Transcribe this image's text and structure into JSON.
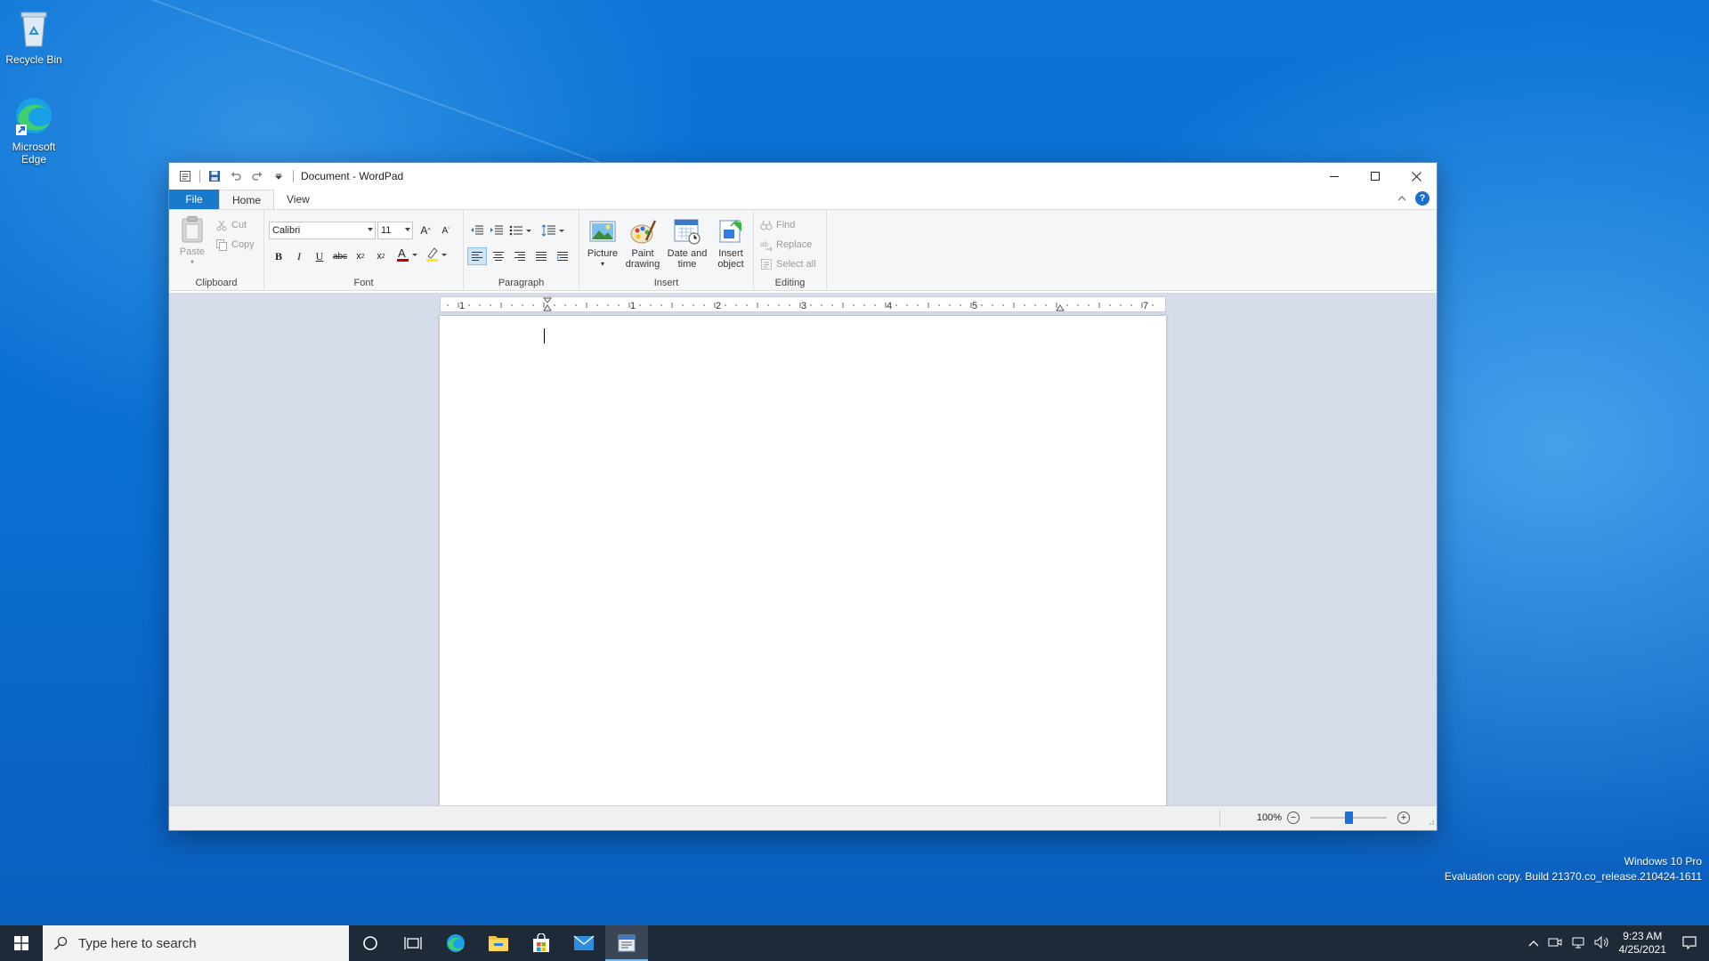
{
  "desktop": {
    "icons": [
      {
        "label": "Recycle Bin",
        "icon": "recycle-bin-icon"
      },
      {
        "label": "Microsoft Edge",
        "icon": "edge-icon"
      }
    ],
    "watermark": {
      "line1": "Windows 10 Pro",
      "line2": "Evaluation copy. Build 21370.co_release.210424-1611"
    }
  },
  "window": {
    "title": "Document - WordPad",
    "tabs": [
      {
        "label": "File"
      },
      {
        "label": "Home"
      },
      {
        "label": "View"
      }
    ],
    "ribbon": {
      "clipboard": {
        "group": "Clipboard",
        "paste": "Paste",
        "cut": "Cut",
        "copy": "Copy"
      },
      "font": {
        "group": "Font",
        "family": "Calibri",
        "size": "11"
      },
      "paragraph": {
        "group": "Paragraph"
      },
      "insert": {
        "group": "Insert",
        "picture": "Picture",
        "paint_line1": "Paint",
        "paint_line2": "drawing",
        "datetime_line1": "Date and",
        "datetime_line2": "time",
        "object_line1": "Insert",
        "object_line2": "object"
      },
      "editing": {
        "group": "Editing",
        "find": "Find",
        "replace": "Replace",
        "select_all": "Select all"
      }
    },
    "ruler_numbers": [
      "1",
      "1",
      "2",
      "3",
      "4",
      "5",
      "7"
    ],
    "status": {
      "zoom": "100%",
      "zoom_level": 0.5
    }
  },
  "taskbar": {
    "search_placeholder": "Type here to search",
    "time": "9:23 AM",
    "date": "4/25/2021"
  },
  "colors": {
    "accent": "#1979ca",
    "desktop": "#0a6fd2",
    "taskbar": "#1f2a38"
  }
}
